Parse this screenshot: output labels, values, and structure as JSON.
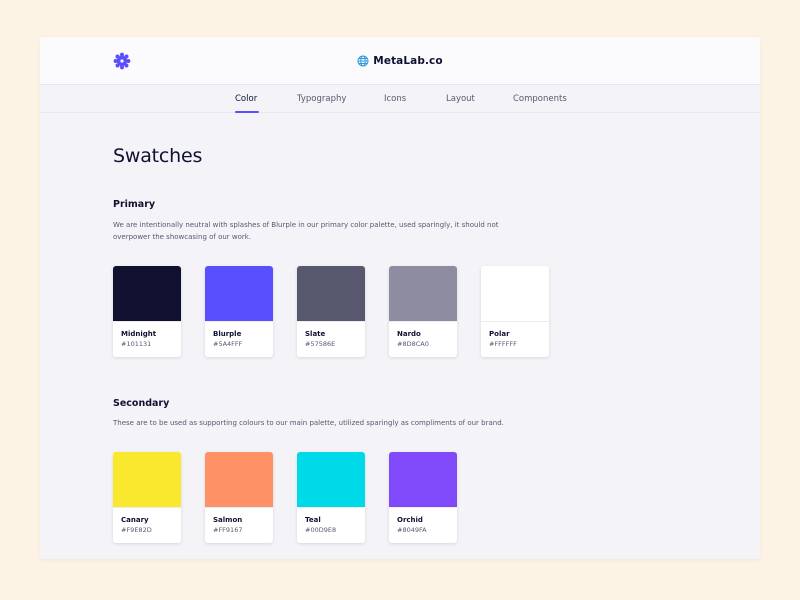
{
  "header": {
    "brand_name": "MetaLab.co",
    "logo_icon": "metalab-flower-icon",
    "brand_icon": "globe-icon",
    "logo_color": "#5A4FFF",
    "brand_icon_color": "#2D9CDB"
  },
  "tabs": [
    {
      "label": "Color",
      "active": true
    },
    {
      "label": "Typography",
      "active": false
    },
    {
      "label": "Icons",
      "active": false
    },
    {
      "label": "Layout",
      "active": false
    },
    {
      "label": "Components",
      "active": false
    }
  ],
  "accent": "#5A4FFF",
  "page": {
    "title": "Swatches"
  },
  "primary": {
    "title": "Primary",
    "description": "We are intentionally neutral with splashes of Blurple in our primary color palette, used sparingly, it should not overpower the showcasing of our work.",
    "swatches": [
      {
        "name": "Midnight",
        "hex": "#101131"
      },
      {
        "name": "Blurple",
        "hex": "#5A4FFF"
      },
      {
        "name": "Slate",
        "hex": "#57586E"
      },
      {
        "name": "Nardo",
        "hex": "#8D8CA0"
      },
      {
        "name": "Polar",
        "hex": "#FFFFFF"
      }
    ]
  },
  "secondary": {
    "title": "Secondary",
    "description": "These are to be used as supporting colours to our main palette, utilized sparingly as compliments of our brand.",
    "swatches": [
      {
        "name": "Canary",
        "hex": "#F9E82D"
      },
      {
        "name": "Salmon",
        "hex": "#FF9167"
      },
      {
        "name": "Teal",
        "hex": "#00D9E8"
      },
      {
        "name": "Orchid",
        "hex": "#8049FA"
      }
    ]
  }
}
